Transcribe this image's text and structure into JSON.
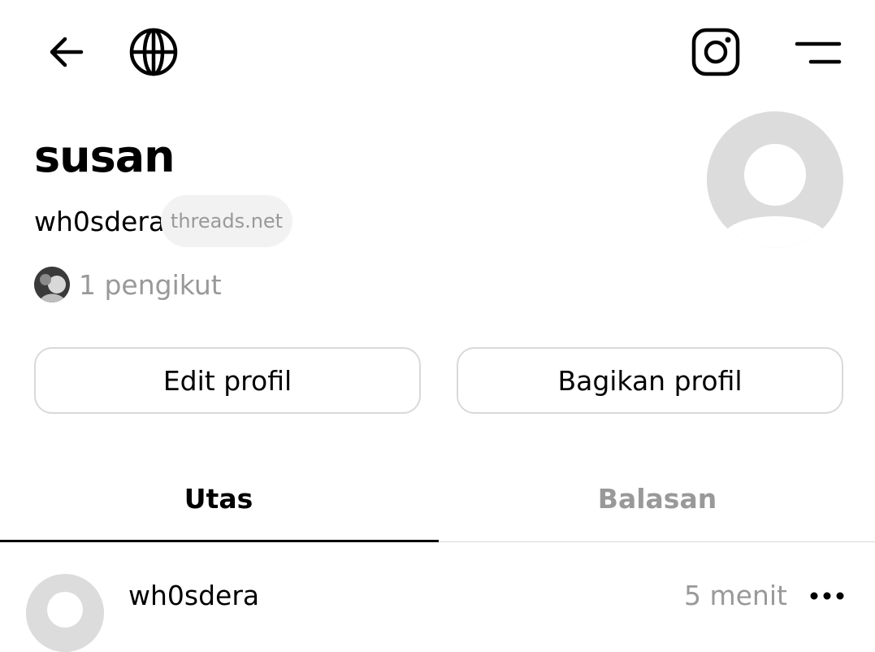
{
  "header": {
    "back_icon": "arrow-left-icon",
    "globe_icon": "globe-icon",
    "instagram_icon": "instagram-icon",
    "menu_icon": "menu-icon"
  },
  "profile": {
    "display_name": "susan",
    "username": "wh0sdera",
    "domain_badge": "threads.net",
    "followers_text": "1 pengikut",
    "avatar_icon": "default-avatar-icon"
  },
  "actions": {
    "edit_label": "Edit profil",
    "share_label": "Bagikan profil"
  },
  "tabs": [
    {
      "label": "Utas",
      "active": true
    },
    {
      "label": "Balasan",
      "active": false
    }
  ],
  "post": {
    "username": "wh0sdera",
    "time": "5 menit",
    "more_icon": "more-horizontal-icon"
  },
  "colors": {
    "text": "#000000",
    "muted": "#999999",
    "border": "#d9d9d9",
    "badge_bg": "#f2f2f2",
    "avatar_bg": "#dcdcdc"
  }
}
